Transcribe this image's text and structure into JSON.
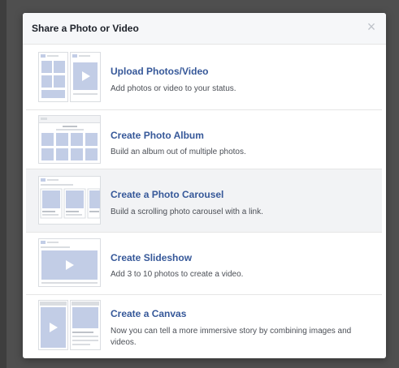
{
  "dialog": {
    "title": "Share a Photo or Video",
    "close_glyph": "×"
  },
  "options": [
    {
      "title": "Upload Photos/Video",
      "description": "Add photos or video to your status."
    },
    {
      "title": "Create Photo Album",
      "description": "Build an album out of multiple photos."
    },
    {
      "title": "Create a Photo Carousel",
      "description": "Build a scrolling photo carousel with a link."
    },
    {
      "title": "Create Slideshow",
      "description": "Add 3 to 10 photos to create a video."
    },
    {
      "title": "Create a Canvas",
      "description": "Now you can tell a more immersive story by combining images and videos."
    }
  ],
  "colors": {
    "link_blue": "#365899",
    "placeholder": "#c2cde6",
    "highlight_row": "#f2f3f5"
  }
}
